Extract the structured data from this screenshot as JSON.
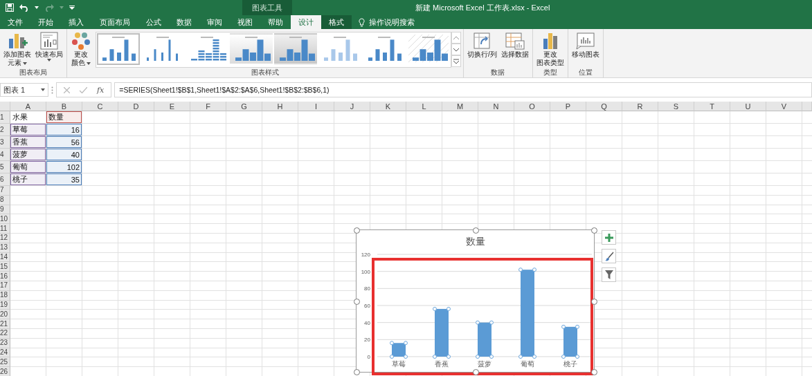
{
  "window": {
    "title": "新建 Microsoft Excel 工作表.xlsx  -  Excel",
    "context_group": "图表工具"
  },
  "tabs": [
    {
      "label": "文件",
      "selected": false,
      "kind": "normal"
    },
    {
      "label": "开始",
      "selected": false,
      "kind": "normal"
    },
    {
      "label": "插入",
      "selected": false,
      "kind": "normal"
    },
    {
      "label": "页面布局",
      "selected": false,
      "kind": "normal"
    },
    {
      "label": "公式",
      "selected": false,
      "kind": "normal"
    },
    {
      "label": "数据",
      "selected": false,
      "kind": "normal"
    },
    {
      "label": "审阅",
      "selected": false,
      "kind": "normal"
    },
    {
      "label": "视图",
      "selected": false,
      "kind": "normal"
    },
    {
      "label": "帮助",
      "selected": false,
      "kind": "normal"
    },
    {
      "label": "设计",
      "selected": true,
      "kind": "context"
    },
    {
      "label": "格式",
      "selected": false,
      "kind": "context"
    }
  ],
  "tell_me": {
    "label": "操作说明搜索"
  },
  "ribbon": {
    "groups": [
      {
        "label": "图表布局",
        "items": [
          {
            "kind": "add_element",
            "lines": [
              "添加图表",
              "元素"
            ],
            "dropdown": true
          },
          {
            "kind": "quick_layout",
            "lines": [
              "快速布局"
            ],
            "dropdown": true
          }
        ]
      },
      {
        "label": "图表样式",
        "items": [
          {
            "kind": "change_colors",
            "lines": [
              "更改",
              "颜色"
            ],
            "dropdown": true
          },
          {
            "kind": "gallery",
            "styles": [
              {
                "kind": "plain",
                "selected": true
              },
              {
                "kind": "thin",
                "selected": false
              },
              {
                "kind": "striped",
                "selected": false
              },
              {
                "kind": "shaded",
                "selected": false
              },
              {
                "kind": "gray",
                "selected": false
              },
              {
                "kind": "pale",
                "selected": false
              },
              {
                "kind": "plain",
                "selected": false
              },
              {
                "kind": "hatched",
                "selected": false
              }
            ]
          }
        ]
      },
      {
        "label": "数据",
        "items": [
          {
            "kind": "switch_row_col",
            "lines": [
              "切换行/列"
            ],
            "dropdown": false
          },
          {
            "kind": "select_data",
            "lines": [
              "选择数据"
            ],
            "dropdown": false
          }
        ]
      },
      {
        "label": "类型",
        "items": [
          {
            "kind": "change_type",
            "lines": [
              "更改",
              "图表类型"
            ],
            "dropdown": false
          }
        ]
      },
      {
        "label": "位置",
        "items": [
          {
            "kind": "move_chart",
            "lines": [
              "移动图表"
            ],
            "dropdown": false
          }
        ]
      }
    ]
  },
  "formula_bar": {
    "name_box": "图表 1",
    "fx": "fx",
    "formula": "=SERIES(Sheet1!$B$1,Sheet1!$A$2:$A$6,Sheet1!$B$2:$B$6,1)"
  },
  "sheet": {
    "columns": [
      "A",
      "B",
      "C",
      "D",
      "E",
      "F",
      "G",
      "H",
      "I",
      "J",
      "K",
      "L",
      "M",
      "N",
      "O",
      "P",
      "Q",
      "R",
      "S",
      "T",
      "U",
      "V"
    ],
    "rows": [
      {
        "number": "1",
        "cells": [
          {
            "text": "水果",
            "kind": "text"
          },
          {
            "text": "数量",
            "kind": "text",
            "color": "#c0504d"
          }
        ]
      },
      {
        "number": "2",
        "cells": [
          {
            "text": "草莓",
            "kind": "text",
            "color": "#8064a2"
          },
          {
            "text": "16",
            "kind": "number",
            "color": "#4a7ebb"
          }
        ]
      },
      {
        "number": "3",
        "cells": [
          {
            "text": "香蕉",
            "kind": "text",
            "color": "#8064a2"
          },
          {
            "text": "56",
            "kind": "number",
            "color": "#4a7ebb"
          }
        ]
      },
      {
        "number": "4",
        "cells": [
          {
            "text": "菠萝",
            "kind": "text",
            "color": "#8064a2"
          },
          {
            "text": "40",
            "kind": "number",
            "color": "#4a7ebb"
          }
        ]
      },
      {
        "number": "5",
        "cells": [
          {
            "text": "葡萄",
            "kind": "text",
            "color": "#8064a2"
          },
          {
            "text": "102",
            "kind": "number",
            "color": "#4a7ebb"
          }
        ]
      },
      {
        "number": "6",
        "cells": [
          {
            "text": "桃子",
            "kind": "text",
            "color": "#8064a2"
          },
          {
            "text": "35",
            "kind": "number",
            "color": "#4a7ebb"
          }
        ]
      },
      {
        "number": "7"
      },
      {
        "number": "8"
      },
      {
        "number": "9"
      },
      {
        "number": "10"
      },
      {
        "number": "11"
      },
      {
        "number": "12"
      },
      {
        "number": "13"
      },
      {
        "number": "14"
      },
      {
        "number": "15"
      },
      {
        "number": "16"
      },
      {
        "number": "17"
      },
      {
        "number": "18"
      },
      {
        "number": "19"
      },
      {
        "number": "20"
      },
      {
        "number": "21"
      },
      {
        "number": "22"
      },
      {
        "number": "23"
      },
      {
        "number": "24"
      },
      {
        "number": "25"
      },
      {
        "number": "26"
      }
    ]
  },
  "chart": {
    "selected": true,
    "highlight_box": true,
    "chart_data": {
      "type": "bar",
      "title": "数量",
      "categories": [
        "草莓",
        "香蕉",
        "菠萝",
        "葡萄",
        "桃子"
      ],
      "series": [
        {
          "color": "#5b9bd5",
          "values": [
            16,
            56,
            40,
            102,
            35
          ]
        }
      ],
      "grid": true,
      "ylim": [
        0,
        120
      ],
      "yticks": [
        0,
        20,
        40,
        60,
        80,
        100,
        120
      ]
    }
  }
}
